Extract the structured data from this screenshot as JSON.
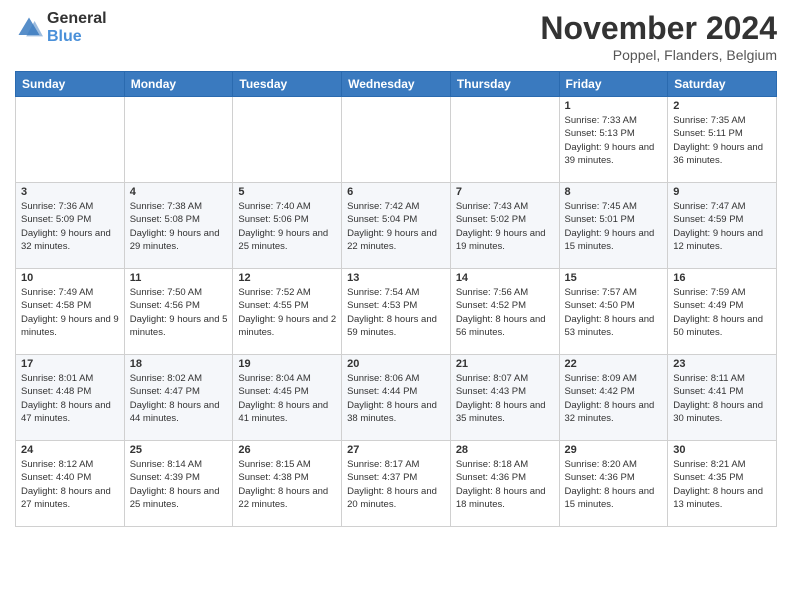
{
  "logo": {
    "general": "General",
    "blue": "Blue"
  },
  "title": "November 2024",
  "location": "Poppel, Flanders, Belgium",
  "headers": [
    "Sunday",
    "Monday",
    "Tuesday",
    "Wednesday",
    "Thursday",
    "Friday",
    "Saturday"
  ],
  "weeks": [
    [
      {
        "day": "",
        "sunrise": "",
        "sunset": "",
        "daylight": ""
      },
      {
        "day": "",
        "sunrise": "",
        "sunset": "",
        "daylight": ""
      },
      {
        "day": "",
        "sunrise": "",
        "sunset": "",
        "daylight": ""
      },
      {
        "day": "",
        "sunrise": "",
        "sunset": "",
        "daylight": ""
      },
      {
        "day": "",
        "sunrise": "",
        "sunset": "",
        "daylight": ""
      },
      {
        "day": "1",
        "sunrise": "Sunrise: 7:33 AM",
        "sunset": "Sunset: 5:13 PM",
        "daylight": "Daylight: 9 hours and 39 minutes."
      },
      {
        "day": "2",
        "sunrise": "Sunrise: 7:35 AM",
        "sunset": "Sunset: 5:11 PM",
        "daylight": "Daylight: 9 hours and 36 minutes."
      }
    ],
    [
      {
        "day": "3",
        "sunrise": "Sunrise: 7:36 AM",
        "sunset": "Sunset: 5:09 PM",
        "daylight": "Daylight: 9 hours and 32 minutes."
      },
      {
        "day": "4",
        "sunrise": "Sunrise: 7:38 AM",
        "sunset": "Sunset: 5:08 PM",
        "daylight": "Daylight: 9 hours and 29 minutes."
      },
      {
        "day": "5",
        "sunrise": "Sunrise: 7:40 AM",
        "sunset": "Sunset: 5:06 PM",
        "daylight": "Daylight: 9 hours and 25 minutes."
      },
      {
        "day": "6",
        "sunrise": "Sunrise: 7:42 AM",
        "sunset": "Sunset: 5:04 PM",
        "daylight": "Daylight: 9 hours and 22 minutes."
      },
      {
        "day": "7",
        "sunrise": "Sunrise: 7:43 AM",
        "sunset": "Sunset: 5:02 PM",
        "daylight": "Daylight: 9 hours and 19 minutes."
      },
      {
        "day": "8",
        "sunrise": "Sunrise: 7:45 AM",
        "sunset": "Sunset: 5:01 PM",
        "daylight": "Daylight: 9 hours and 15 minutes."
      },
      {
        "day": "9",
        "sunrise": "Sunrise: 7:47 AM",
        "sunset": "Sunset: 4:59 PM",
        "daylight": "Daylight: 9 hours and 12 minutes."
      }
    ],
    [
      {
        "day": "10",
        "sunrise": "Sunrise: 7:49 AM",
        "sunset": "Sunset: 4:58 PM",
        "daylight": "Daylight: 9 hours and 9 minutes."
      },
      {
        "day": "11",
        "sunrise": "Sunrise: 7:50 AM",
        "sunset": "Sunset: 4:56 PM",
        "daylight": "Daylight: 9 hours and 5 minutes."
      },
      {
        "day": "12",
        "sunrise": "Sunrise: 7:52 AM",
        "sunset": "Sunset: 4:55 PM",
        "daylight": "Daylight: 9 hours and 2 minutes."
      },
      {
        "day": "13",
        "sunrise": "Sunrise: 7:54 AM",
        "sunset": "Sunset: 4:53 PM",
        "daylight": "Daylight: 8 hours and 59 minutes."
      },
      {
        "day": "14",
        "sunrise": "Sunrise: 7:56 AM",
        "sunset": "Sunset: 4:52 PM",
        "daylight": "Daylight: 8 hours and 56 minutes."
      },
      {
        "day": "15",
        "sunrise": "Sunrise: 7:57 AM",
        "sunset": "Sunset: 4:50 PM",
        "daylight": "Daylight: 8 hours and 53 minutes."
      },
      {
        "day": "16",
        "sunrise": "Sunrise: 7:59 AM",
        "sunset": "Sunset: 4:49 PM",
        "daylight": "Daylight: 8 hours and 50 minutes."
      }
    ],
    [
      {
        "day": "17",
        "sunrise": "Sunrise: 8:01 AM",
        "sunset": "Sunset: 4:48 PM",
        "daylight": "Daylight: 8 hours and 47 minutes."
      },
      {
        "day": "18",
        "sunrise": "Sunrise: 8:02 AM",
        "sunset": "Sunset: 4:47 PM",
        "daylight": "Daylight: 8 hours and 44 minutes."
      },
      {
        "day": "19",
        "sunrise": "Sunrise: 8:04 AM",
        "sunset": "Sunset: 4:45 PM",
        "daylight": "Daylight: 8 hours and 41 minutes."
      },
      {
        "day": "20",
        "sunrise": "Sunrise: 8:06 AM",
        "sunset": "Sunset: 4:44 PM",
        "daylight": "Daylight: 8 hours and 38 minutes."
      },
      {
        "day": "21",
        "sunrise": "Sunrise: 8:07 AM",
        "sunset": "Sunset: 4:43 PM",
        "daylight": "Daylight: 8 hours and 35 minutes."
      },
      {
        "day": "22",
        "sunrise": "Sunrise: 8:09 AM",
        "sunset": "Sunset: 4:42 PM",
        "daylight": "Daylight: 8 hours and 32 minutes."
      },
      {
        "day": "23",
        "sunrise": "Sunrise: 8:11 AM",
        "sunset": "Sunset: 4:41 PM",
        "daylight": "Daylight: 8 hours and 30 minutes."
      }
    ],
    [
      {
        "day": "24",
        "sunrise": "Sunrise: 8:12 AM",
        "sunset": "Sunset: 4:40 PM",
        "daylight": "Daylight: 8 hours and 27 minutes."
      },
      {
        "day": "25",
        "sunrise": "Sunrise: 8:14 AM",
        "sunset": "Sunset: 4:39 PM",
        "daylight": "Daylight: 8 hours and 25 minutes."
      },
      {
        "day": "26",
        "sunrise": "Sunrise: 8:15 AM",
        "sunset": "Sunset: 4:38 PM",
        "daylight": "Daylight: 8 hours and 22 minutes."
      },
      {
        "day": "27",
        "sunrise": "Sunrise: 8:17 AM",
        "sunset": "Sunset: 4:37 PM",
        "daylight": "Daylight: 8 hours and 20 minutes."
      },
      {
        "day": "28",
        "sunrise": "Sunrise: 8:18 AM",
        "sunset": "Sunset: 4:36 PM",
        "daylight": "Daylight: 8 hours and 18 minutes."
      },
      {
        "day": "29",
        "sunrise": "Sunrise: 8:20 AM",
        "sunset": "Sunset: 4:36 PM",
        "daylight": "Daylight: 8 hours and 15 minutes."
      },
      {
        "day": "30",
        "sunrise": "Sunrise: 8:21 AM",
        "sunset": "Sunset: 4:35 PM",
        "daylight": "Daylight: 8 hours and 13 minutes."
      }
    ]
  ]
}
